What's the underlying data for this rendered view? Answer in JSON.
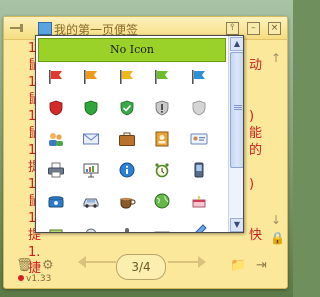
{
  "note": {
    "title": "我的第一页便签",
    "left_lines": [
      "1.",
      "鼠",
      "1.",
      "鼠",
      "1.",
      "鼠",
      "1.",
      "提",
      "1.",
      "鼠",
      "1.",
      "提",
      "1.",
      "捷"
    ],
    "right_lines": [
      "动",
      "",
      ")",
      "",
      "能",
      "的",
      "",
      ")",
      "",
      "",
      "",
      "快",
      "",
      ""
    ],
    "bottom_line": "…………"
  },
  "picker": {
    "no_icon_label": "No Icon",
    "rows": [
      [
        "flag-red-icon",
        "flag-orange-icon",
        "flag-amber-icon",
        "flag-green-icon",
        "flag-blue-icon"
      ],
      [
        "shield-red-icon",
        "shield-green-icon",
        "shield-check-icon",
        "shield-warning-icon",
        "shield-gray-icon"
      ],
      [
        "users-icon",
        "mail-icon",
        "briefcase-icon",
        "contact-book-icon",
        "id-card-icon"
      ],
      [
        "printer-icon",
        "presentation-icon",
        "info-icon",
        "alarm-clock-icon",
        "mobile-phone-icon"
      ],
      [
        "telephone-icon",
        "car-icon",
        "coffee-cup-icon",
        "globe-icon",
        "cake-icon"
      ],
      [
        "misc-icon",
        "tool-icon",
        "microphone-icon",
        "keyboard-icon",
        "pen-icon"
      ]
    ]
  },
  "footer": {
    "page": "3/4",
    "version": "v1.33"
  },
  "colors": {
    "note_bg": "#fce89a",
    "text_red": "#cc2020",
    "no_icon_green": "#9bd22a"
  }
}
